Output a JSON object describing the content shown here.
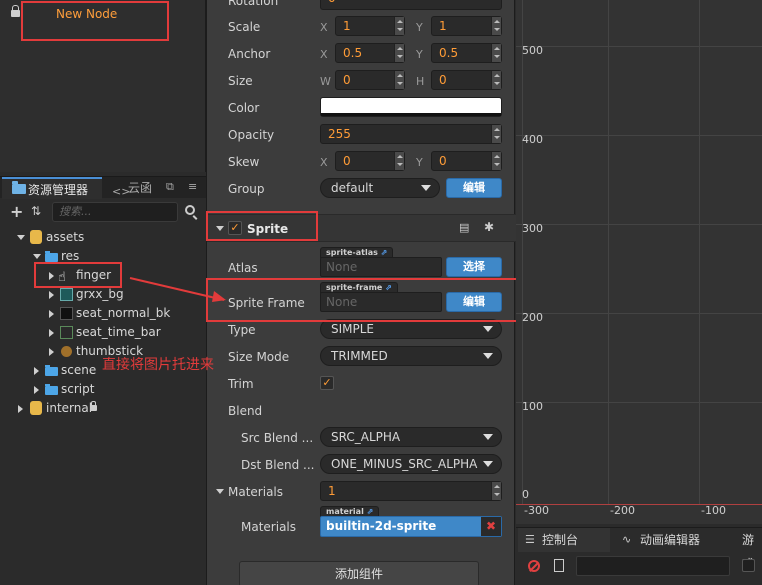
{
  "hierarchy": {
    "node_label": "New Node"
  },
  "assets": {
    "tab_active": "资源管理器",
    "tab_other": "云函",
    "search_placeholder": "搜索...",
    "tree": [
      {
        "label": "assets"
      },
      {
        "label": "res"
      },
      {
        "label": "finger"
      },
      {
        "label": "grxx_bg"
      },
      {
        "label": "seat_normal_bk"
      },
      {
        "label": "seat_time_bar"
      },
      {
        "label": "thumbstick"
      },
      {
        "label": "scene"
      },
      {
        "label": "script"
      },
      {
        "label": "internal"
      }
    ]
  },
  "inspector": {
    "rotation_label": "Rotation",
    "rotation_value": "0",
    "scale": {
      "label": "Scale",
      "x_label": "X",
      "x": "1",
      "y_label": "Y",
      "y": "1"
    },
    "anchor": {
      "label": "Anchor",
      "x_label": "X",
      "x": "0.5",
      "y_label": "Y",
      "y": "0.5"
    },
    "size": {
      "label": "Size",
      "w_label": "W",
      "w": "0",
      "h_label": "H",
      "h": "0"
    },
    "color_label": "Color",
    "opacity": {
      "label": "Opacity",
      "value": "255"
    },
    "skew": {
      "label": "Skew",
      "x_label": "X",
      "x": "0",
      "y_label": "Y",
      "y": "0"
    },
    "group": {
      "label": "Group",
      "value": "default",
      "button": "编辑"
    },
    "sprite": {
      "title": "Sprite",
      "atlas": {
        "label": "Atlas",
        "tag": "sprite-atlas",
        "value": "None",
        "button": "选择"
      },
      "frame": {
        "label": "Sprite Frame",
        "tag": "sprite-frame",
        "value": "None",
        "button": "编辑"
      },
      "type": {
        "label": "Type",
        "value": "SIMPLE"
      },
      "size_mode": {
        "label": "Size Mode",
        "value": "TRIMMED"
      },
      "trim_label": "Trim",
      "blend_label": "Blend",
      "src_blend": {
        "label": "Src Blend ...",
        "value": "SRC_ALPHA"
      },
      "dst_blend": {
        "label": "Dst Blend ...",
        "value": "ONE_MINUS_SRC_ALPHA"
      },
      "materials_count": {
        "label": "Materials",
        "value": "1"
      },
      "materials_item": {
        "label": "Materials",
        "tag": "material",
        "value": "builtin-2d-sprite"
      }
    },
    "add_component": "添加组件"
  },
  "scene": {
    "y_labels": [
      "500",
      "400",
      "300",
      "200",
      "100",
      "0"
    ],
    "x_labels": [
      "-300",
      "-200",
      "-100"
    ]
  },
  "console": {
    "tab_console": "控制台",
    "tab_anim": "动画编辑器",
    "tab_game": "游戏"
  },
  "annotation": {
    "text": "直接将图片托进来"
  },
  "colors": {
    "accent_orange": "#ff9c37",
    "button_blue": "#3f88c8",
    "annotation_red": "#e23b3b"
  },
  "icons": [
    "lock-icon",
    "folder-icon",
    "cloud-icon",
    "plus-icon",
    "sort-icon",
    "search-icon",
    "book-icon",
    "gear-icon",
    "clear-icon",
    "link-icon"
  ]
}
